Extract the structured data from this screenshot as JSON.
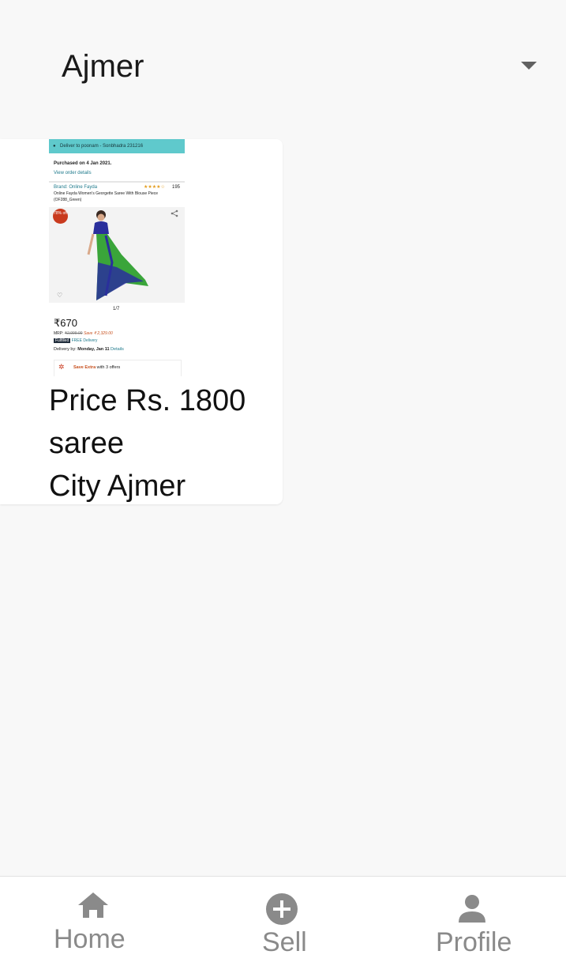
{
  "header": {
    "city": "Ajmer"
  },
  "listing": {
    "line1": "Price Rs. 1800",
    "line2": "saree",
    "line3": "City Ajmer",
    "thumbnail": {
      "deliver_to": "Deliver to poonam - Sonbhadra 231216",
      "purchased": "Purchased on 4 Jan 2021.",
      "view_order": "View order details",
      "brand": "Brand: Online Fayda",
      "stars": "★★★★☆",
      "review_count": "195",
      "product_title": "Online Fayda Women's Georgette Saree With Blouse Piece",
      "product_code": "(OF288_Green)",
      "discount_badge": "78% off",
      "page_indicator": "1/7",
      "price": "₹670",
      "mrp_label": "MRP:",
      "mrp_value": "₹2,999.00",
      "save_text": "Save ₹ 2,329.00",
      "fulfilled": "Fulfilled",
      "free_delivery": "FREE Delivery",
      "delivery_label": "Delivery by:",
      "delivery_date": "Monday, Jan 11",
      "details_link": "Details",
      "save_extra": "Save Extra",
      "offers": "with 3 offers"
    }
  },
  "nav": {
    "home": "Home",
    "sell": "Sell",
    "profile": "Profile"
  },
  "colors": {
    "icon_gray": "#8a8a8a",
    "thumb_bar": "#5fc9cc",
    "dropdown": "#616161"
  }
}
